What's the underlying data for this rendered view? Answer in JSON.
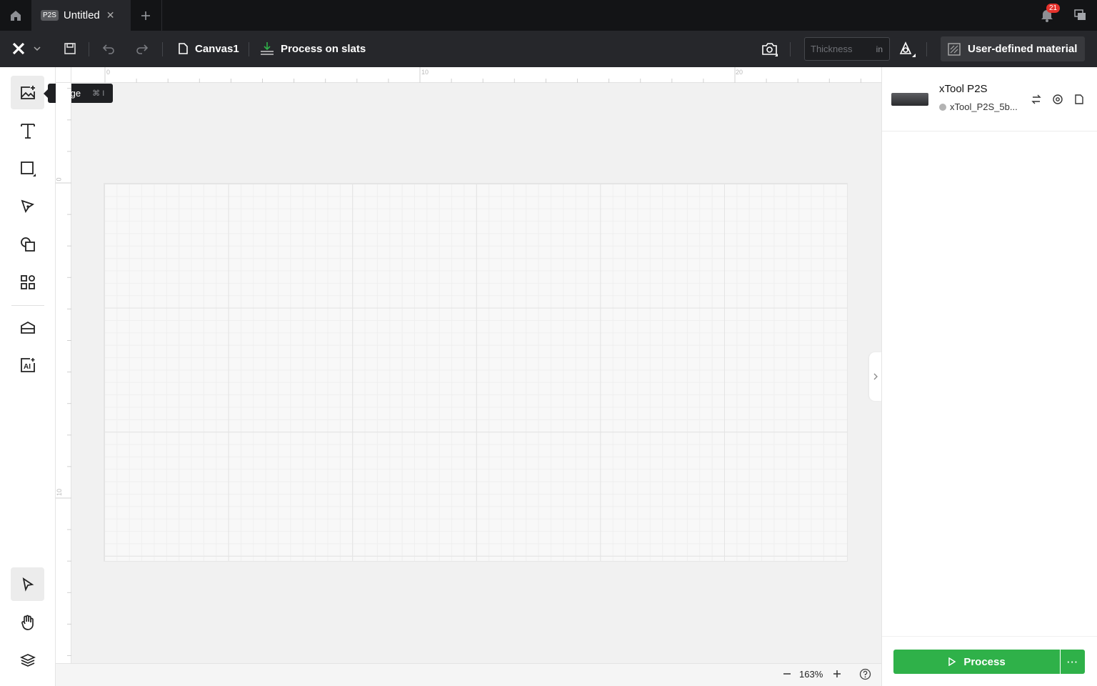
{
  "titlebar": {
    "tab_badge": "P2S",
    "tab_title": "Untitled",
    "tab_close": "✕",
    "notification_count": "21"
  },
  "toolbar": {
    "canvas_name": "Canvas1",
    "process_mode": "Process on slats",
    "thickness_placeholder": "Thickness",
    "thickness_unit": "in",
    "material_label": "User-defined material"
  },
  "tooltip": {
    "label": "Image",
    "shortcut": "⌘ I"
  },
  "rulers": {
    "top": [
      "0",
      "10",
      "20"
    ],
    "left": [
      "0",
      "10"
    ]
  },
  "device": {
    "name": "xTool P2S",
    "status_text": "xTool_P2S_5b..."
  },
  "zoom": {
    "value": "163%"
  },
  "process": {
    "label": "Process",
    "more": "···"
  },
  "colors": {
    "accent_green": "#2fb149",
    "titlebar_bg": "#131416",
    "toolbar_bg": "#26272b",
    "badge_red": "#e5322c"
  }
}
